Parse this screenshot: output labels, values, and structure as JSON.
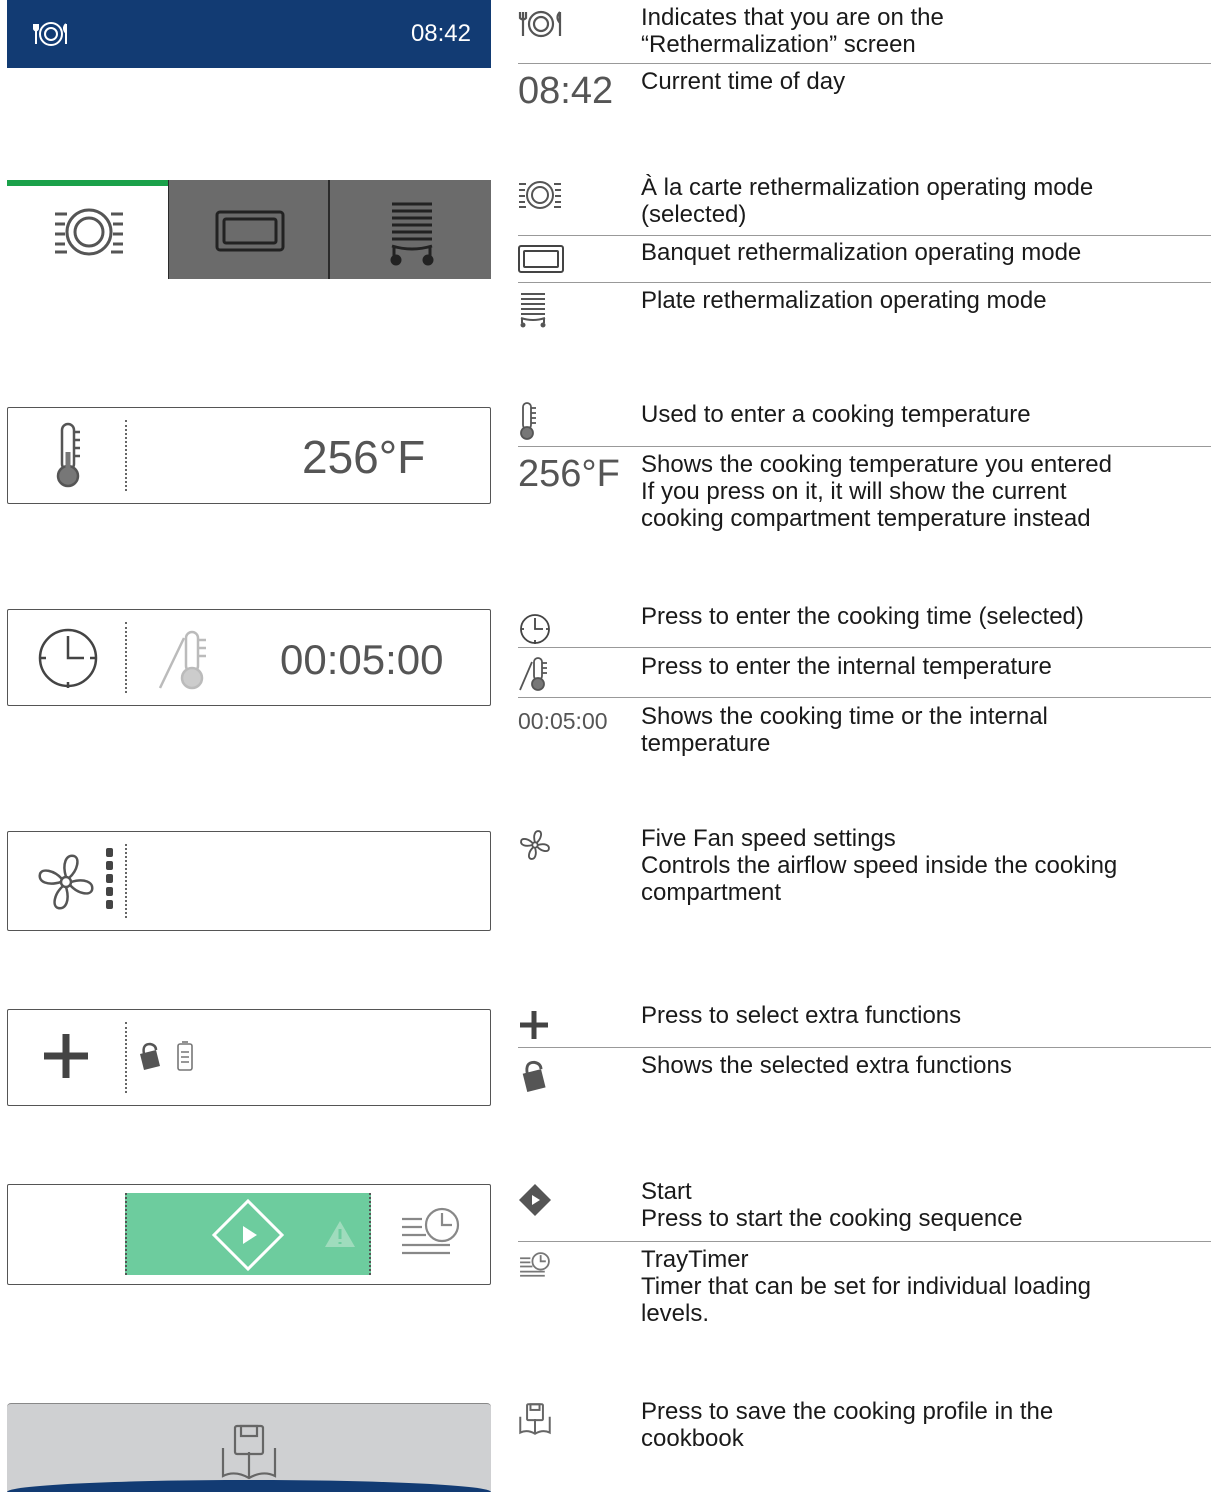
{
  "header": {
    "time": "08:42"
  },
  "temperature_panel": {
    "value": "256°F"
  },
  "time_panel": {
    "value": "00:05:00"
  },
  "legend": {
    "rethermalization_icon": "Indicates that you are on the\n“Rethermalization” screen",
    "time_sample": "08:42",
    "time_desc": "Current time of day",
    "alacarte_desc": "À la carte rethermalization operating mode\n(selected)",
    "banquet_desc": "Banquet rethermalization operating mode",
    "plate_desc": "Plate rethermalization operating mode",
    "temp_entry_desc": "Used to enter a cooking temperature",
    "temp_sample": "256°F",
    "temp_shown_desc": "Shows the cooking temperature you entered\nIf you press on it, it will show the current\ncooking compartment temperature instead",
    "cooking_time_desc": "Press to enter the cooking time (selected)",
    "core_temp_desc": "Press to enter the internal temperature",
    "time_value_sample": "00:05:00",
    "time_value_desc": "Shows the cooking time or the internal\ntemperature",
    "fan_desc": "Five Fan speed settings\nControls the airflow speed inside the cooking\ncompartment",
    "plus_desc": "Press to select extra functions",
    "extra_shown_desc": "Shows the selected extra functions",
    "start_desc": "Start\nPress to start the cooking sequence",
    "traytimer_desc": "TrayTimer\nTimer that can be set for individual loading\nlevels.",
    "save_desc": "Press to save the cooking profile in the\ncookbook"
  },
  "icons": [
    "plate-cutlery-icon",
    "alacarte-icon",
    "banquet-icon",
    "plate-rack-icon",
    "thermometer-icon",
    "clock-icon",
    "core-probe-icon",
    "fan-icon",
    "plus-icon",
    "lock-icon",
    "battery-icon",
    "start-icon",
    "warning-icon",
    "traytimer-icon",
    "save-cookbook-icon"
  ],
  "colors": {
    "header_blue": "#123b73",
    "selected_green": "#1aa14a",
    "start_green": "#6dcc9e",
    "tab_grey": "#6b6b6b"
  }
}
